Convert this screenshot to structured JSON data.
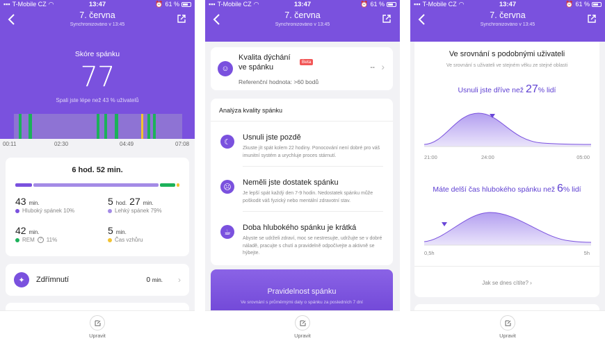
{
  "status": {
    "carrier": "T-Mobile CZ",
    "time": "13:47",
    "battery": "61 %"
  },
  "header": {
    "title": "7. června",
    "sync": "Synchronizováno v 13:45"
  },
  "bottom": {
    "edit_label": "Upravit"
  },
  "score": {
    "title": "Skóre spánku",
    "value": "77",
    "desc": "Spali jste lépe než 43 % uživatelů"
  },
  "timeline": {
    "ticks": [
      "00:11",
      "02:30",
      "04:49",
      "07:08"
    ]
  },
  "summary": {
    "total": "6 hod. 52 min.",
    "deep": {
      "value": "43",
      "unit": "min.",
      "label": "Hluboký spánek 10%",
      "color": "#7a51de"
    },
    "light": {
      "value_h": "5",
      "unit_h": "hod.",
      "value_m": "27",
      "unit_m": "min.",
      "label": "Lehký spánek 79%",
      "color": "#a48be6"
    },
    "rem": {
      "value": "42",
      "unit": "min.",
      "label": "REM",
      "extra": "11%",
      "color": "#1cb15a"
    },
    "awake": {
      "value": "5",
      "unit": "min.",
      "label": "Čas vzhůru",
      "color": "#f2c232"
    }
  },
  "nap": {
    "label": "Zdřímnutí",
    "value": "0",
    "unit": "min."
  },
  "breathing": {
    "title_line1": "Kvalita dýchání",
    "title_line2": "ve spánku",
    "badge": "Beta",
    "value": "--",
    "ref": "Referenční hodnota: >60 bodů"
  },
  "analysis": {
    "title": "Analýza kvality spánku",
    "items": [
      {
        "title": "Usnuli jste pozdě",
        "text": "Zkuste jít spát kolem 22 hodiny. Ponocování není dobré pro váš imunitní systém a urychluje proces stárnutí.",
        "icon": "moon-icon"
      },
      {
        "title": "Neměli jste dostatek spánku",
        "text": "Je lepší spát každý den 7-9 hodin. Nedostatek spánku může poškodit váš fyzický nebo mentální zdravotní stav.",
        "icon": "sad-face-icon"
      },
      {
        "title": "Doba hlubokého spánku je krátká",
        "text": "Abyste se udrželi zdraví, moc se nestresujte, udržujte se v dobré náladě, pracujte s chutí a pravidelně odpočívejte a aktivně se hýbejte.",
        "icon": "cup-icon"
      }
    ]
  },
  "regularity": {
    "title": "Pravidelnost spánku",
    "text": "Ve srovnání s průměrnými daty o spánku za posledních 7 dní"
  },
  "comparison": {
    "title": "Ve srovnání s podobnými uživateli",
    "subtitle": "Ve srovnání s uživateli ve stejném věku ze stejné oblasti",
    "first_pre": "Usnuli jste dříve než",
    "first_val": "27",
    "first_post": "% lidí",
    "first_ticks": [
      "21:00",
      "24:00",
      "05:00"
    ],
    "second_pre": "Máte delší čas hlubokého spánku než",
    "second_val": "6",
    "second_post": "% lidí",
    "second_ticks": [
      "0,5h",
      "5h"
    ],
    "feel": "Jak se dnes cítíte?"
  },
  "colors": {
    "accent": "#7a51de",
    "rem": "#1cb15a",
    "awake": "#f2c232"
  }
}
